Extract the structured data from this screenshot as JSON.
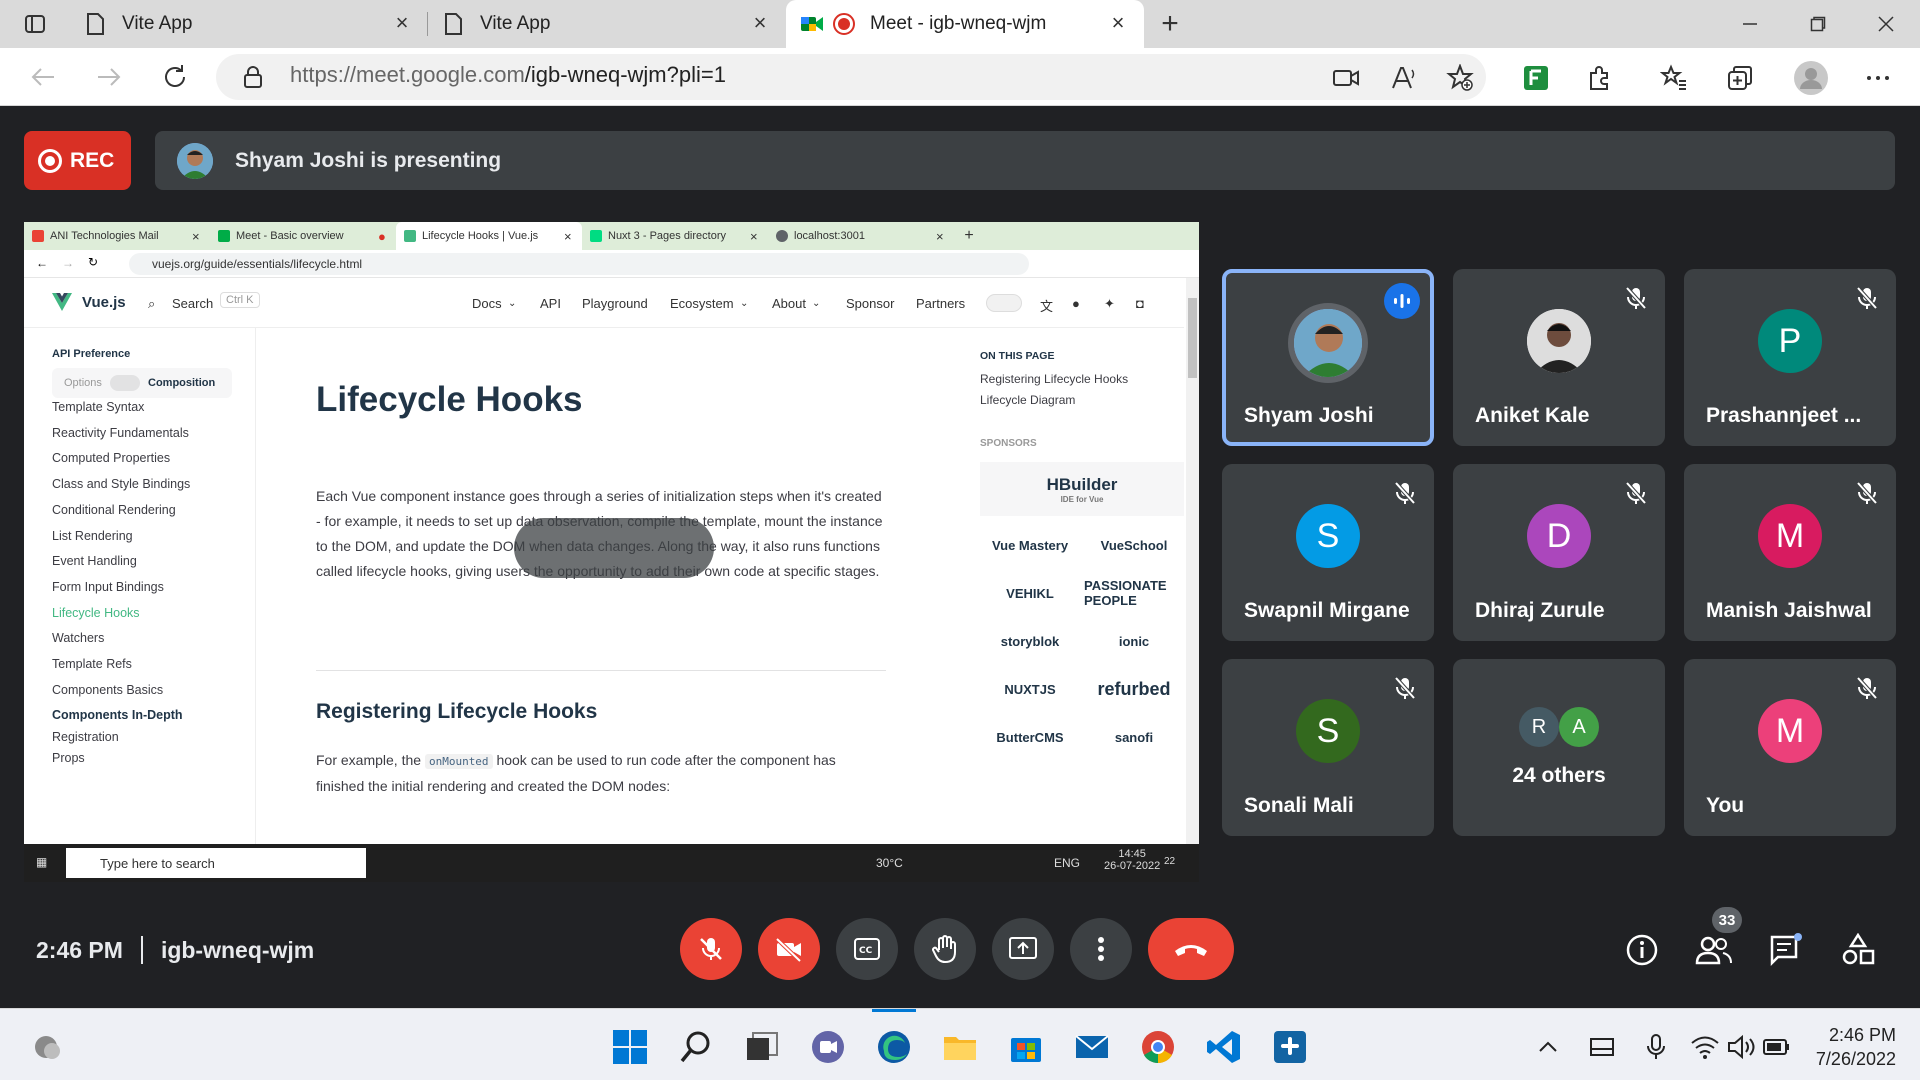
{
  "browser": {
    "tabs": [
      {
        "title": "Vite App"
      },
      {
        "title": "Vite App"
      },
      {
        "title": "Meet - igb-wneq-wjm"
      }
    ],
    "url_host": "https://meet.google.com",
    "url_path": "/igb-wneq-wjm?pli=1"
  },
  "meet": {
    "rec_label": "REC",
    "presenting_text": "Shyam Joshi is presenting",
    "time": "2:46 PM",
    "meeting_code": "igb-wneq-wjm",
    "people_count": "33",
    "participants": [
      {
        "name": "Shyam Joshi",
        "initial": "",
        "color": "#3c4043"
      },
      {
        "name": "Aniket Kale",
        "initial": "",
        "color": "#e8eaed"
      },
      {
        "name": "Prashannjeet ...",
        "initial": "P",
        "color": "#00897b"
      },
      {
        "name": "Swapnil Mirgane",
        "initial": "S",
        "color": "#039be5"
      },
      {
        "name": "Dhiraj Zurule",
        "initial": "D",
        "color": "#ab47bc"
      },
      {
        "name": "Manish Jaishwal",
        "initial": "M",
        "color": "#d81b60"
      },
      {
        "name": "Sonali Mali",
        "initial": "S",
        "color": "#33691e"
      },
      {
        "name": "24 others",
        "initial": "",
        "color": "#3c4043"
      },
      {
        "name": "You",
        "initial": "M",
        "color": "#ec407a"
      }
    ],
    "others_initials": [
      "R",
      "A"
    ]
  },
  "shared": {
    "tabs": [
      "ANI Technologies Mail",
      "Meet - Basic overview",
      "Lifecycle Hooks | Vue.js",
      "Nuxt 3 - Pages directory",
      "localhost:3001"
    ],
    "url": "vuejs.org/guide/essentials/lifecycle.html",
    "brand": "Vue.js",
    "search": "Search",
    "search_key": "Ctrl K",
    "nav": [
      "Docs",
      "API",
      "Playground",
      "Ecosystem",
      "About",
      "Sponsor",
      "Partners"
    ],
    "api_pref": "API Preference",
    "opt_options": "Options",
    "opt_composition": "Composition",
    "sidebar": [
      "Template Syntax",
      "Reactivity Fundamentals",
      "Computed Properties",
      "Class and Style Bindings",
      "Conditional Rendering",
      "List Rendering",
      "Event Handling",
      "Form Input Bindings",
      "Lifecycle Hooks",
      "Watchers",
      "Template Refs",
      "Components Basics"
    ],
    "sidebar_section": "Components In-Depth",
    "sidebar2": [
      "Registration",
      "Props"
    ],
    "title": "Lifecycle Hooks",
    "intro": "Each Vue component instance goes through a series of initialization steps when it's created - for example, it needs to set up data observation, compile the template, mount the instance to the DOM, and update the DOM when data changes. Along the way, it also runs functions called lifecycle hooks, giving users the opportunity to add their own code at specific stages.",
    "h2": "Registering Lifecycle Hooks",
    "p2_a": "For example, the",
    "p2_code": "onMounted",
    "p2_b": "hook can be used to run code after the component has finished the initial rendering and created the DOM nodes:",
    "on_this_page": "ON THIS PAGE",
    "toc": [
      "Registering Lifecycle Hooks",
      "Lifecycle Diagram"
    ],
    "sponsors_label": "SPONSORS",
    "sponsors": [
      "HBuilder",
      "IDE for Vue",
      "Vue Mastery",
      "VueSchool",
      "VEHIKL",
      "PASSIONATE PEOPLE",
      "storyblok",
      "ionic",
      "NUXTJS",
      "refurbed",
      "ButterCMS",
      "sanofi"
    ],
    "taskbar_search": "Type here to search",
    "weather": "30°C",
    "lang": "ENG",
    "clock_time": "14:45",
    "clock_date": "26-07-2022",
    "notif": "22"
  },
  "windows": {
    "time": "2:46 PM",
    "date": "7/26/2022"
  }
}
